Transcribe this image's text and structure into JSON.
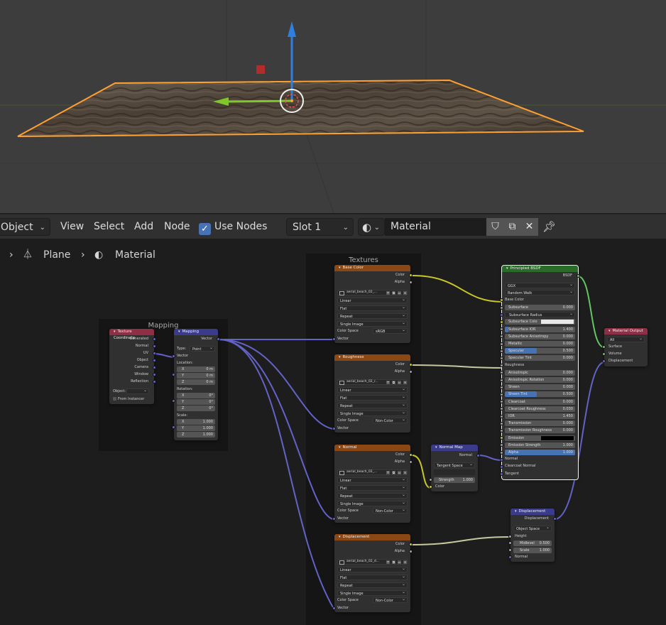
{
  "header": {
    "mode": "Object",
    "menus": [
      "View",
      "Select",
      "Add",
      "Node"
    ],
    "use_nodes_label": "Use Nodes",
    "use_nodes_checked": true,
    "slot": "Slot 1",
    "material_name": "Material"
  },
  "breadcrumb": {
    "object": "Plane",
    "material": "Material"
  },
  "frames": {
    "mapping": "Mapping",
    "textures": "Textures"
  },
  "texcoord": {
    "title": "Texture Coordinate",
    "outputs": [
      "Generated",
      "Normal",
      "UV",
      "Object",
      "Camera",
      "Window",
      "Reflection"
    ],
    "object_label": "Object:",
    "from_instancer": "From Instancer"
  },
  "mapping": {
    "title": "Mapping",
    "out_vector": "Vector",
    "type_label": "Type:",
    "type_value": "Point",
    "in_vector": "Vector",
    "location_label": "Location:",
    "rotation_label": "Rotation:",
    "scale_label": "Scale:",
    "location": [
      {
        "axis": "X",
        "value": "0 m"
      },
      {
        "axis": "Y",
        "value": "0 m"
      },
      {
        "axis": "Z",
        "value": "0 m"
      }
    ],
    "rotation": [
      {
        "axis": "X",
        "value": "0°"
      },
      {
        "axis": "Y",
        "value": "0°"
      },
      {
        "axis": "Z",
        "value": "0°"
      }
    ],
    "scale": [
      {
        "axis": "X",
        "value": "1.000"
      },
      {
        "axis": "Y",
        "value": "1.000"
      },
      {
        "axis": "Z",
        "value": "1.000"
      }
    ]
  },
  "textures": [
    {
      "title": "Base Color",
      "image": "aerial_beach_02_...",
      "interpolation": "Linear",
      "projection": "Flat",
      "extension": "Repeat",
      "source": "Single Image",
      "color_space_label": "Color Space",
      "color_space": "sRGB",
      "out_color": "Color",
      "out_alpha": "Alpha",
      "in_vector": "Vector"
    },
    {
      "title": "Roughness",
      "image": "aerial_beach_02_r...",
      "interpolation": "Linear",
      "projection": "Flat",
      "extension": "Repeat",
      "source": "Single Image",
      "color_space_label": "Color Space",
      "color_space": "Non-Color",
      "out_color": "Color",
      "out_alpha": "Alpha",
      "in_vector": "Vector"
    },
    {
      "title": "Normal",
      "image": "aerial_beach_02_...",
      "interpolation": "Linear",
      "projection": "Flat",
      "extension": "Repeat",
      "source": "Single Image",
      "color_space_label": "Color Space",
      "color_space": "Non-Color",
      "out_color": "Color",
      "out_alpha": "Alpha",
      "in_vector": "Vector"
    },
    {
      "title": "Displacement",
      "image": "aerial_beach_02_d...",
      "interpolation": "Linear",
      "projection": "Flat",
      "extension": "Repeat",
      "source": "Single Image",
      "color_space_label": "Color Space",
      "color_space": "Non-Color",
      "out_color": "Color",
      "out_alpha": "Alpha",
      "in_vector": "Vector"
    }
  ],
  "normalmap": {
    "title": "Normal Map",
    "out_normal": "Normal",
    "space": "Tangent Space",
    "uvmap": "",
    "strength_label": "Strength",
    "strength": "1.000",
    "in_color": "Color"
  },
  "bsdf": {
    "title": "Principled BSDF",
    "out": "BSDF",
    "distribution": "GGX",
    "subsurface_method": "Random Walk",
    "base_color_label": "Base Color",
    "rows": [
      {
        "label": "Subsurface",
        "value": "0.000"
      },
      {
        "label": "Subsurface Radius",
        "value": ""
      },
      {
        "label": "Subsurface Colo",
        "value": ""
      },
      {
        "label": "Subsurface IOR",
        "value": "1.400"
      },
      {
        "label": "Subsurface Anisotropy",
        "value": "0.000"
      },
      {
        "label": "Metallic",
        "value": "0.000"
      },
      {
        "label": "Specular",
        "value": "0.500"
      },
      {
        "label": "Specular Tint",
        "value": "0.000"
      },
      {
        "label": "Roughness",
        "value": ""
      },
      {
        "label": "Anisotropic",
        "value": "0.000"
      },
      {
        "label": "Anisotropic Rotation",
        "value": "0.000"
      },
      {
        "label": "Sheen",
        "value": "0.000"
      },
      {
        "label": "Sheen Tint",
        "value": "0.500"
      },
      {
        "label": "Clearcoat",
        "value": "0.000"
      },
      {
        "label": "Clearcoat Roughness",
        "value": "0.030"
      },
      {
        "label": "IOR",
        "value": "1.450"
      },
      {
        "label": "Transmission",
        "value": "0.000"
      },
      {
        "label": "Transmission Roughness",
        "value": "0.000"
      },
      {
        "label": "Emission",
        "value": ""
      },
      {
        "label": "Emission Strength",
        "value": "1.000"
      },
      {
        "label": "Alpha",
        "value": "1.000"
      },
      {
        "label": "Normal",
        "value": ""
      },
      {
        "label": "Clearcoat Normal",
        "value": ""
      },
      {
        "label": "Tangent",
        "value": ""
      }
    ]
  },
  "output": {
    "title": "Material Output",
    "target": "All",
    "inputs": [
      "Surface",
      "Volume",
      "Displacement"
    ]
  },
  "displacement": {
    "title": "Displacement",
    "out": "Displacement",
    "space": "Object Space",
    "height_label": "Height",
    "midlevel_label": "Midlevel",
    "midlevel": "0.500",
    "scale_label": "Scale",
    "scale": "1.000",
    "normal_label": "Normal"
  },
  "colors": {
    "texture_header": "#8b4714",
    "shader_header": "#2a6b2a",
    "input_header": "#8f2f46",
    "vector_header": "#3b3b8b",
    "color_socket": "#c7c729",
    "vector_socket": "#6363c7",
    "shader_socket": "#63c763",
    "selection": "#ffa033"
  }
}
